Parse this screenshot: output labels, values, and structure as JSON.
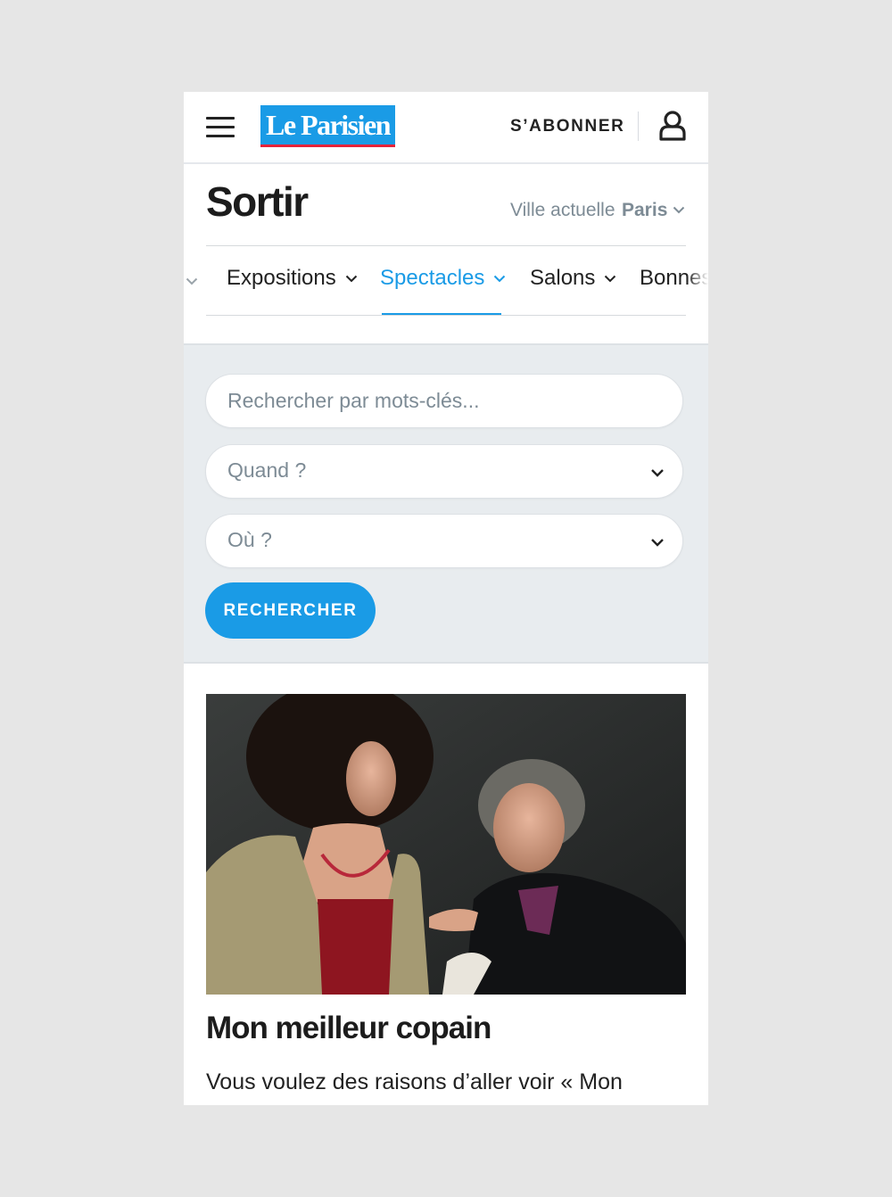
{
  "header": {
    "logo_text": "Le Parisien",
    "subscribe_label": "S’ABONNER",
    "menu_icon": "hamburger-menu-icon",
    "account_icon": "user-account-icon"
  },
  "page": {
    "title": "Sortir",
    "city_label": "Ville actuelle",
    "city_value": "Paris"
  },
  "nav": {
    "items": [
      {
        "label": "Expositions",
        "active": false
      },
      {
        "label": "Spectacles",
        "active": true
      },
      {
        "label": "Salons",
        "active": false
      },
      {
        "label": "Bonnes",
        "active": false
      }
    ]
  },
  "search": {
    "keywords_placeholder": "Rechercher par mots-clés...",
    "when_placeholder": "Quand ?",
    "where_placeholder": "Où ?",
    "submit_label": "RECHERCHER"
  },
  "article": {
    "title": "Mon meilleur copain",
    "excerpt": "Vous voulez des raisons d’aller voir « Mon"
  },
  "colors": {
    "accent": "#1a9be6",
    "logo_stripe": "#e5233b",
    "panel_bg": "#e8ecef",
    "muted_text": "#7d8b95"
  }
}
